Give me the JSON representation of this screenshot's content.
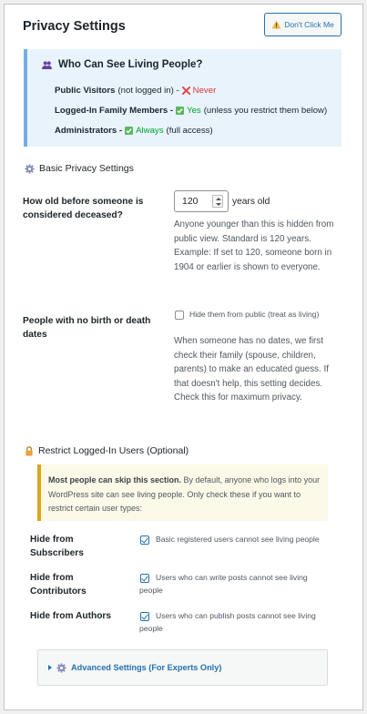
{
  "header": {
    "title": "Privacy Settings",
    "dont_click_label": "Don't Click Me"
  },
  "info_box": {
    "heading": "Who Can See Living People?",
    "rows": [
      {
        "role": "Public Visitors",
        "note": "(not logged in) -",
        "status": "Never",
        "status_icon": "x-icon",
        "extra": ""
      },
      {
        "role": "Logged-In Family Members -",
        "note": "",
        "status": "Yes",
        "status_icon": "check-icon",
        "extra": "(unless you restrict them below)"
      },
      {
        "role": "Administrators -",
        "note": "",
        "status": "Always",
        "status_icon": "check-icon",
        "extra": "(full access)"
      }
    ]
  },
  "basic": {
    "heading": "Basic Privacy Settings",
    "deceased_label": "How old before someone is considered deceased?",
    "deceased_value": "120",
    "deceased_suffix": "years old",
    "deceased_desc": "Anyone younger than this is hidden from public view. Standard is 120 years. Example: If set to 120, someone born in 1904 or earlier is shown to everyone.",
    "nodates_label": "People with no birth or death dates",
    "nodates_checkbox_label": "Hide them from public (treat as living)",
    "nodates_checked": false,
    "nodates_desc": "When someone has no dates, we first check their family (spouse, children, parents) to make an educated guess. If that doesn't help, this setting decides. Check this for maximum privacy."
  },
  "restrict": {
    "heading": "Restrict Logged-In Users (Optional)",
    "notice_bold": "Most people can skip this section.",
    "notice_text": "By default, anyone who logs into your WordPress site can see living people. Only check these if you want to restrict certain user types:",
    "roles": [
      {
        "label": "Hide from Subscribers",
        "checkbox_label": "Basic registered users cannot see living people",
        "checked": true
      },
      {
        "label": "Hide from Contributors",
        "checkbox_label": "Users who can write posts cannot see living people",
        "checked": true
      },
      {
        "label": "Hide from Authors",
        "checkbox_label": "Users who can publish posts cannot see living people",
        "checked": true
      }
    ]
  },
  "advanced": {
    "label": "Advanced Settings (For Experts Only)"
  },
  "colors": {
    "accent": "#2271b1",
    "info_bg": "#e8f3fc",
    "info_border": "#72aee6",
    "notice_bg": "#fcf9e8",
    "notice_border": "#dba617",
    "never": "#d63638"
  }
}
